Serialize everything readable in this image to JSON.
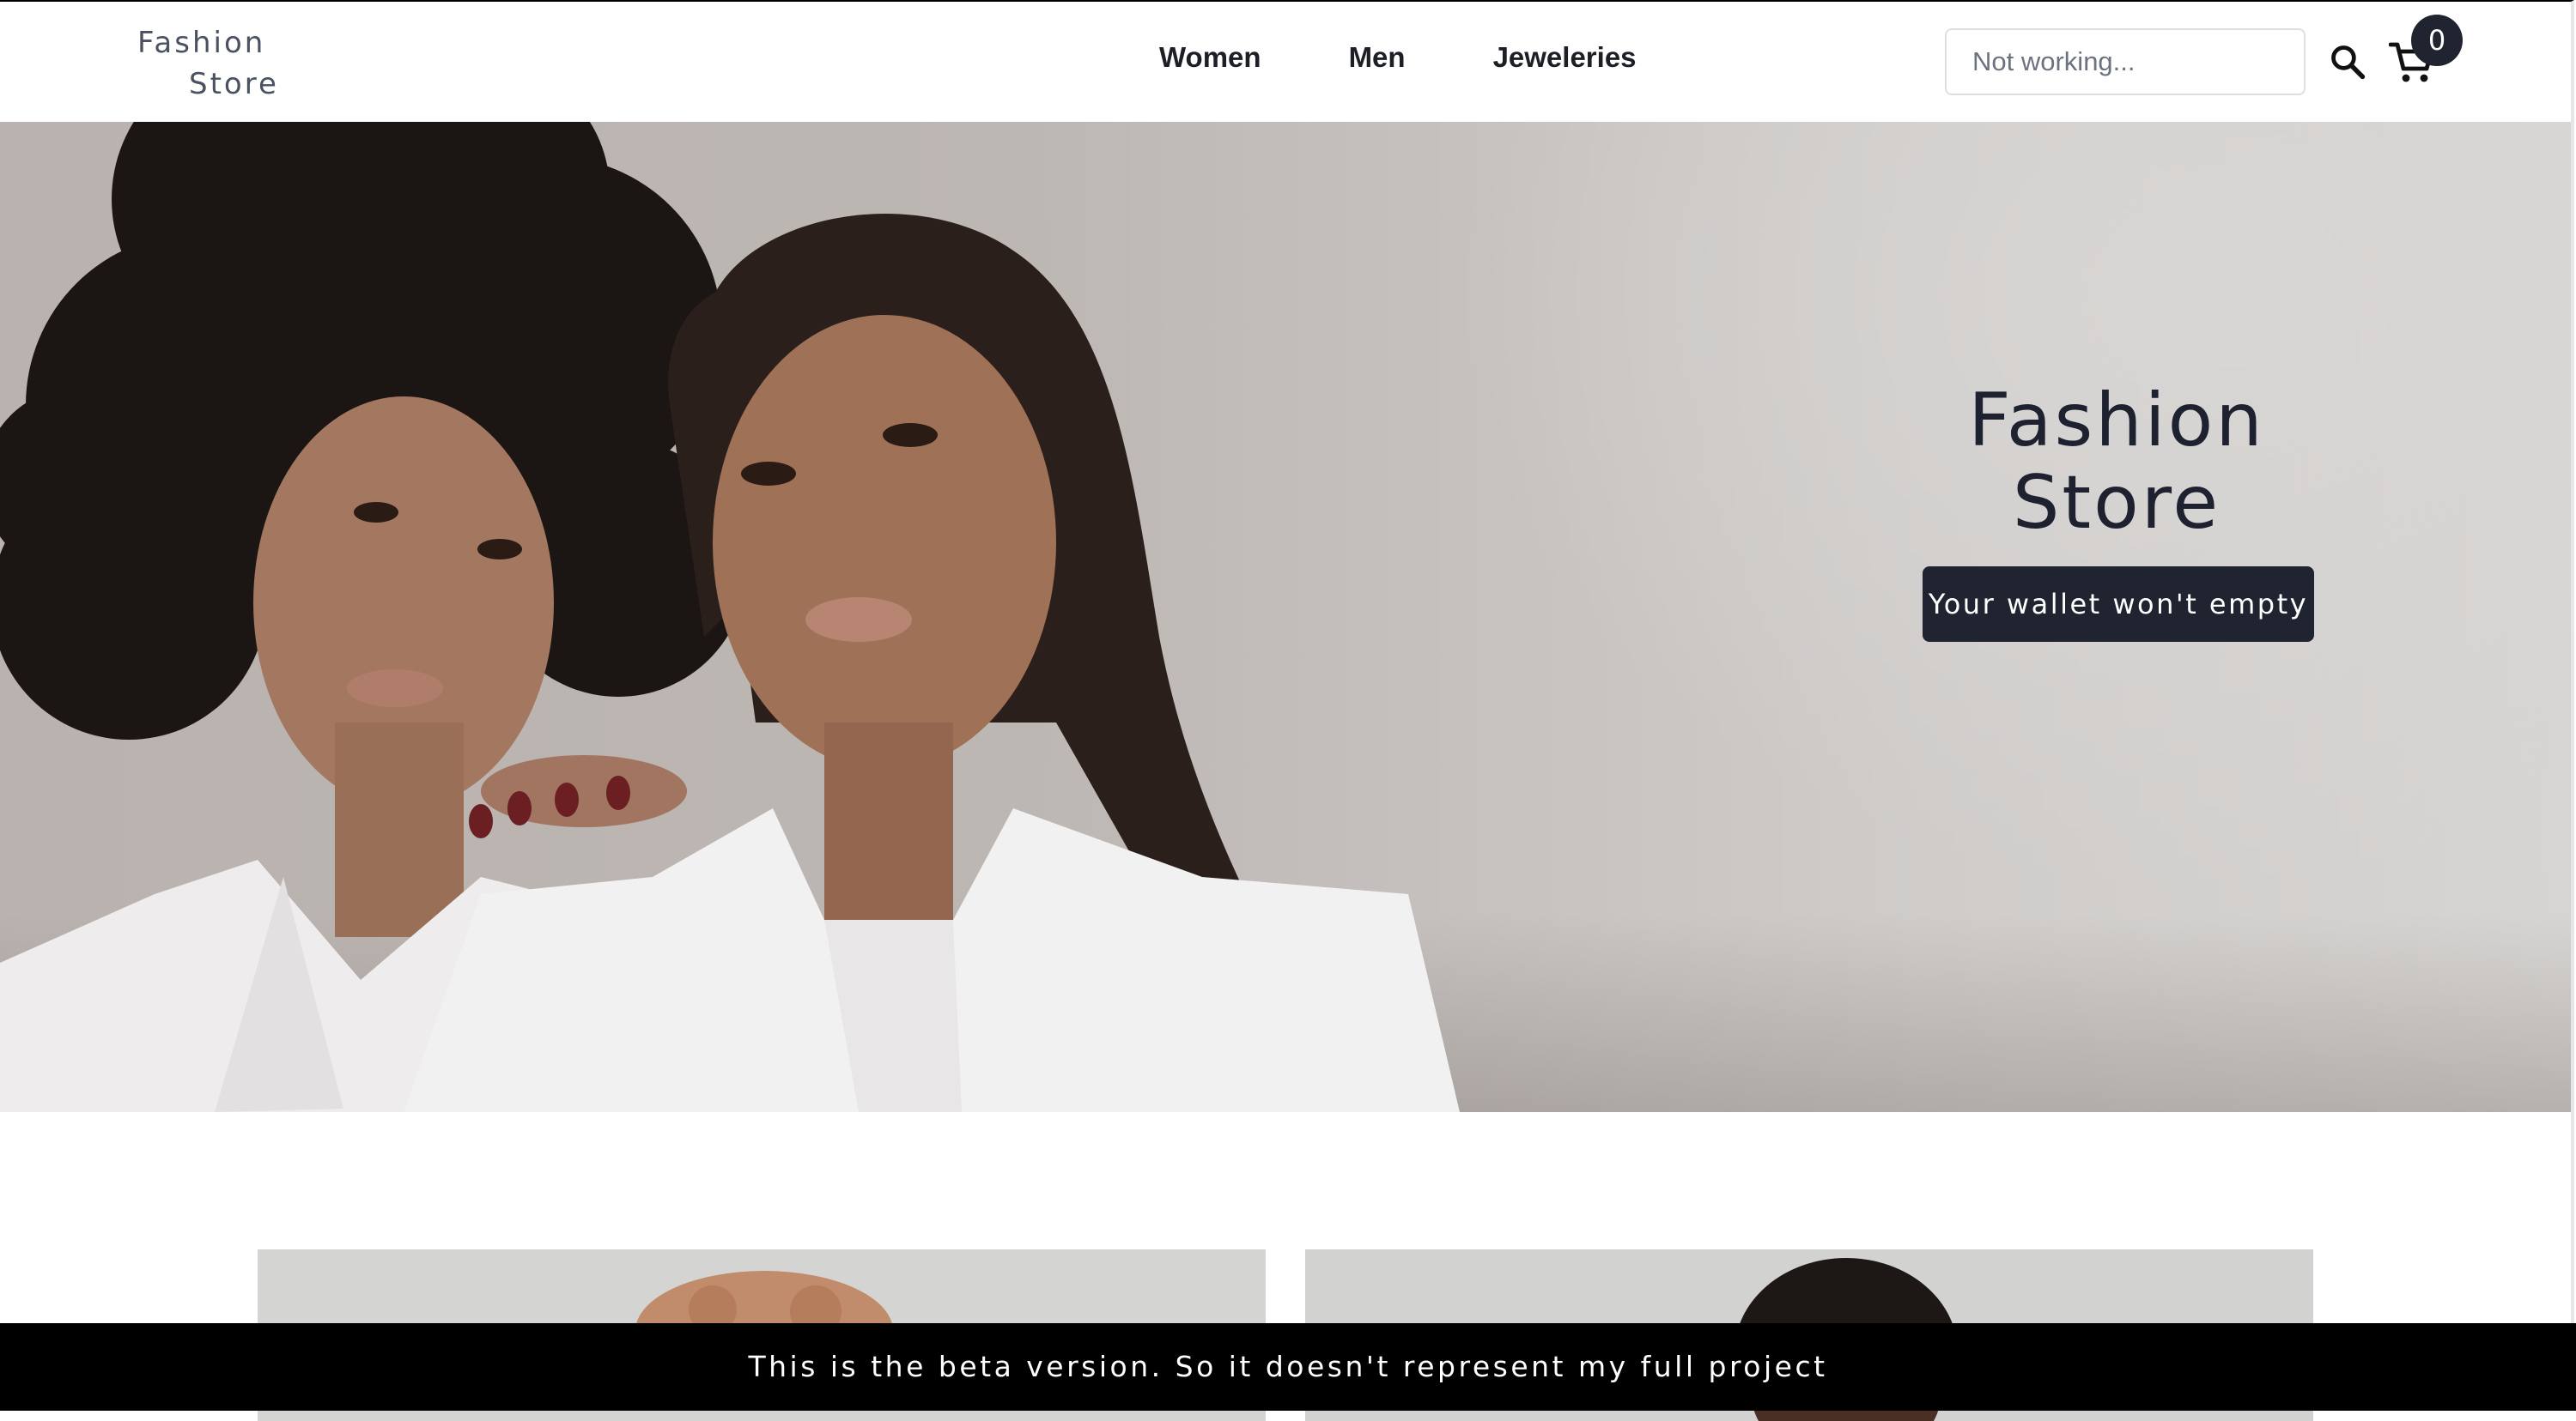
{
  "header": {
    "logo_line1": "Fashion",
    "logo_line2": "Store",
    "nav": [
      {
        "label": "Women"
      },
      {
        "label": "Men"
      },
      {
        "label": "Jeweleries"
      }
    ],
    "search": {
      "placeholder": "Not working...",
      "value": ""
    },
    "cart": {
      "count": "0",
      "icon": "cart-icon"
    },
    "search_icon": "search-icon"
  },
  "hero": {
    "title_line1": "Fashion",
    "title_line2": "Store",
    "cta_label": "Your wallet won't empty"
  },
  "footer_banner": {
    "text": "This is the beta version. So it doesn't represent my full project"
  },
  "colors": {
    "accent": "#1f2430",
    "banner_bg": "#000000",
    "text_dark": "#1c1f26"
  }
}
